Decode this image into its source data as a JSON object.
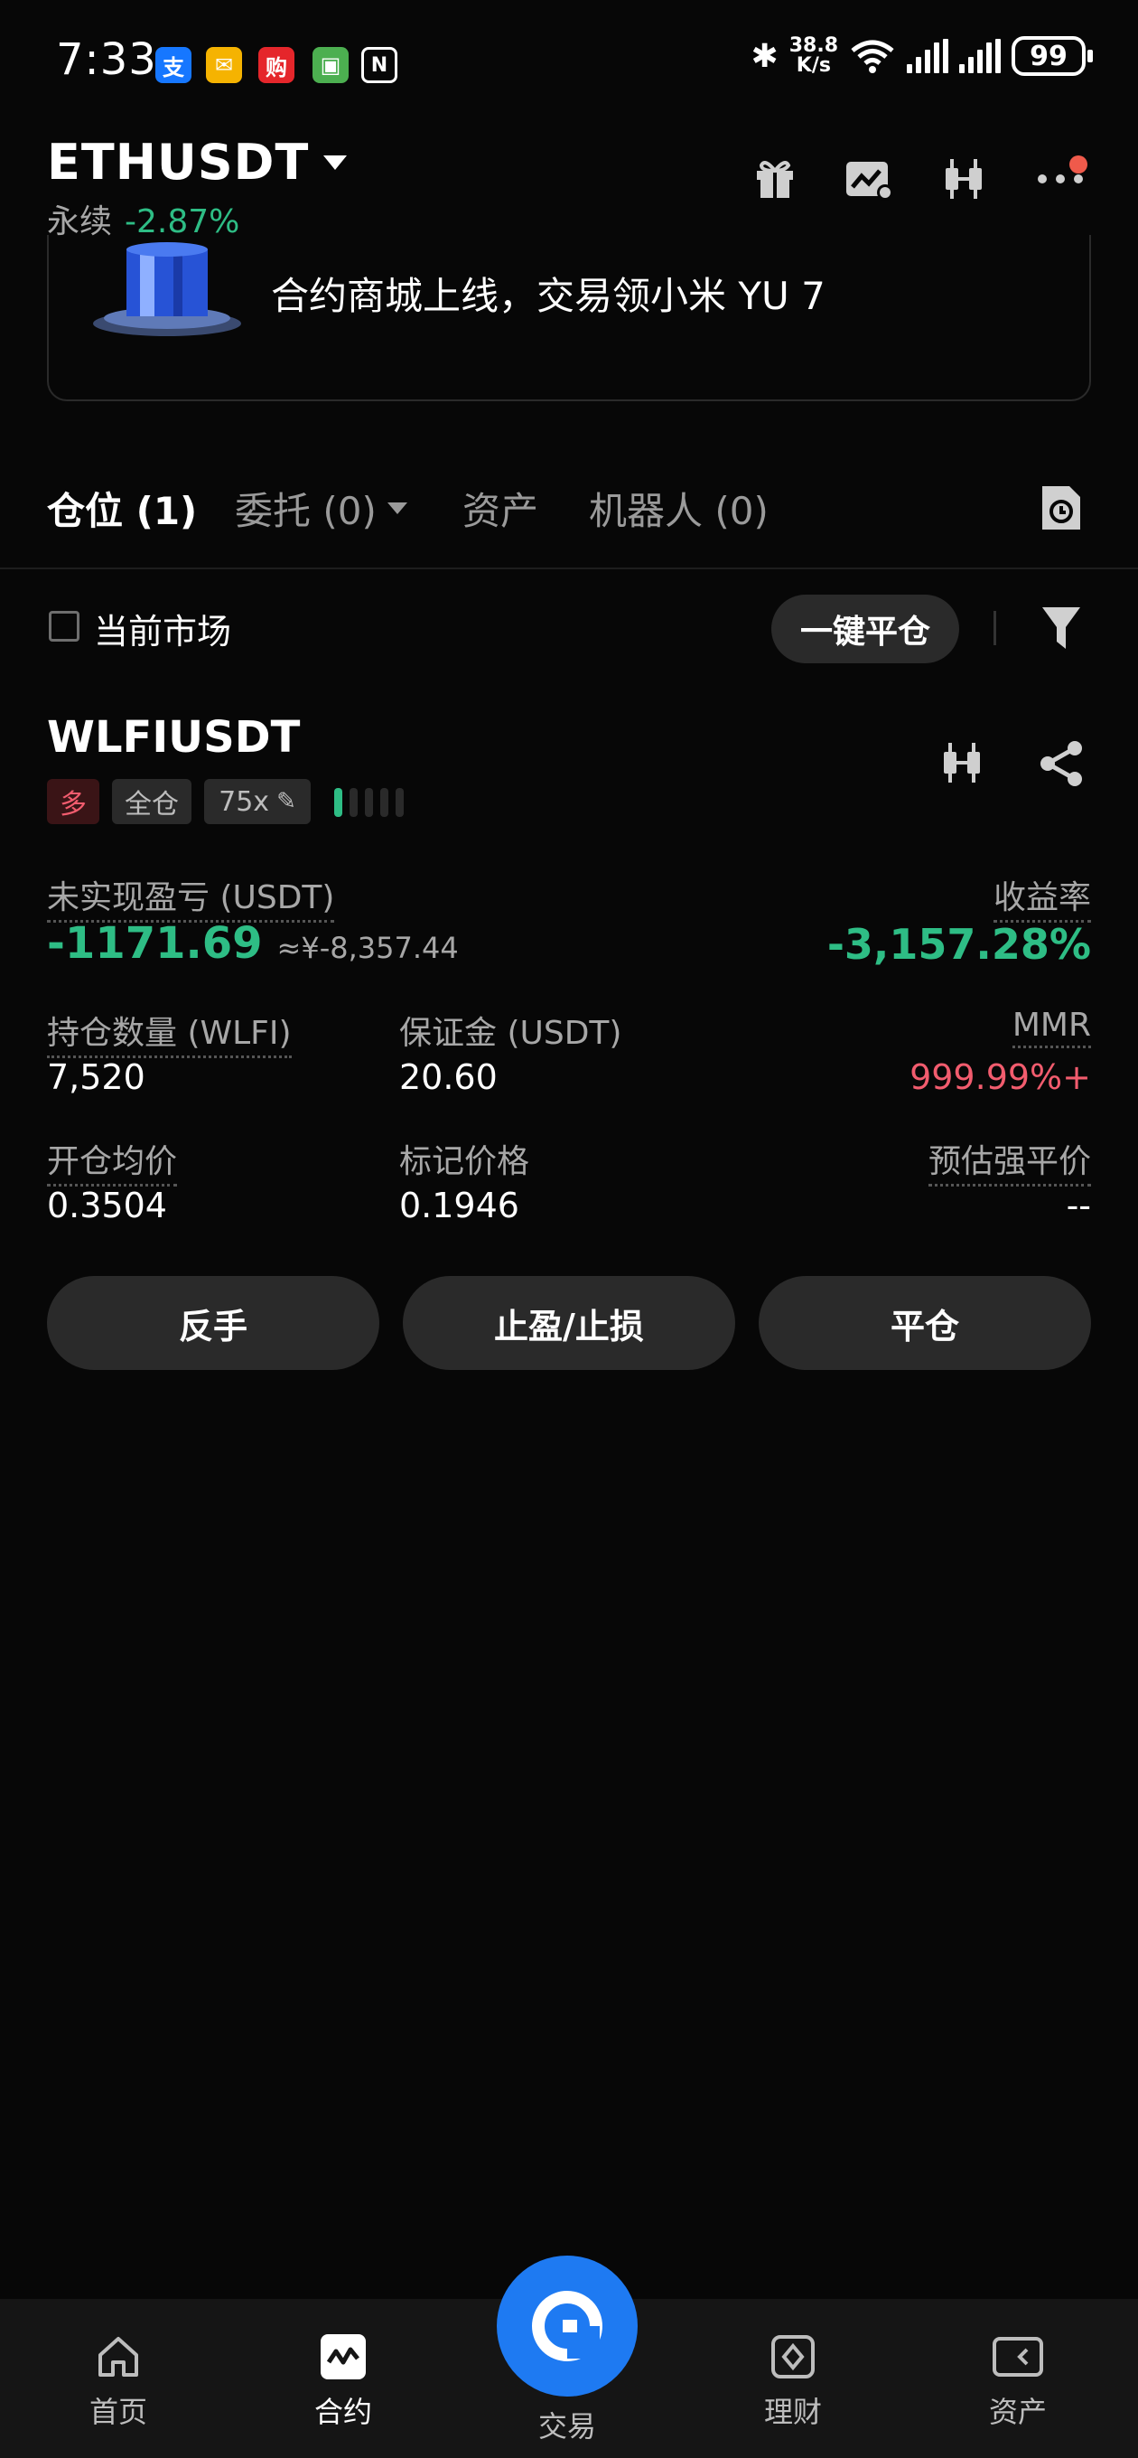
{
  "status_bar": {
    "time": "7:33",
    "net_speed_top": "38.8",
    "net_speed_bottom": "K/s",
    "battery": "99"
  },
  "header": {
    "pair": "ETHUSDT",
    "type": "永续",
    "change": "-2.87%"
  },
  "banner": {
    "text": "合约商城上线，交易领小米 YU 7"
  },
  "tabs": [
    {
      "label": "仓位 (1)"
    },
    {
      "label": "委托 (0)"
    },
    {
      "label": "资产"
    },
    {
      "label": "机器人 (0)"
    }
  ],
  "filter": {
    "checkbox_label": "当前市场",
    "close_all": "一键平仓"
  },
  "position": {
    "symbol": "WLFIUSDT",
    "side": "多",
    "margin_mode": "全仓",
    "leverage": "75x",
    "risk_level_fraction": 0.2,
    "unrealized_pnl_label": "未实现盈亏 (USDT)",
    "unrealized_pnl": "-1171.69",
    "unrealized_pnl_cny": "≈¥-8,357.44",
    "roe_label": "收益率",
    "roe": "-3,157.28%",
    "size_label": "持仓数量 (WLFI)",
    "size": "7,520",
    "margin_label": "保证金 (USDT)",
    "margin": "20.60",
    "mmr_label": "MMR",
    "mmr": "999.99%+",
    "entry_label": "开仓均价",
    "entry": "0.3504",
    "mark_label": "标记价格",
    "mark": "0.1946",
    "liq_label": "预估强平价",
    "liq": "--"
  },
  "actions": {
    "reverse": "反手",
    "tpsl": "止盈/止损",
    "close": "平仓"
  },
  "bottom_nav": [
    {
      "label": "首页",
      "icon": "home-icon"
    },
    {
      "label": "合约",
      "icon": "futures-icon"
    },
    {
      "label": "交易",
      "icon": "trade-icon"
    },
    {
      "label": "理财",
      "icon": "earn-icon"
    },
    {
      "label": "资产",
      "icon": "wallet-icon"
    }
  ],
  "colors": {
    "green": "#2ebd85",
    "red": "#f25c6e",
    "accent_blue": "#1e7af2"
  }
}
